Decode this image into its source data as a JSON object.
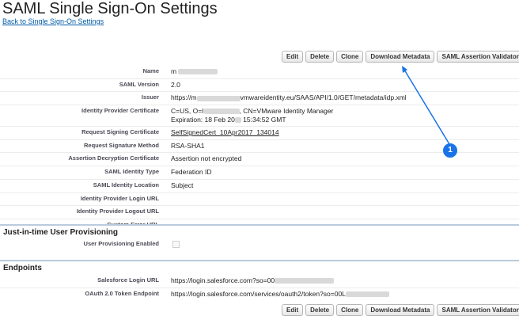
{
  "page": {
    "title": "SAML Single Sign-On Settings",
    "back_link": "Back to Single Sign-On Settings"
  },
  "buttons": {
    "edit": "Edit",
    "delete": "Delete",
    "clone": "Clone",
    "download_metadata": "Download Metadata",
    "saml_assertion_validator": "SAML Assertion Validator"
  },
  "details": {
    "name": {
      "label": "Name",
      "value": "m"
    },
    "saml_version": {
      "label": "SAML Version",
      "value": "2.0"
    },
    "issuer": {
      "label": "Issuer",
      "value_prefix": "https://m",
      "value_suffix": "vmwareidentity.eu/SAAS/API/1.0/GET/metadata/idp.xml"
    },
    "idp_certificate": {
      "label": "Identity Provider Certificate",
      "line1_prefix": "C=US, O=I",
      "line1_suffix": ", CN=VMware Identity Manager",
      "line2_prefix": "Expiration: 18 Feb 20",
      "line2_suffix": " 15:34:52 GMT"
    },
    "request_signing_certificate": {
      "label": "Request Signing Certificate",
      "value": "SelfSignedCert_10Apr2017_134014"
    },
    "request_signature_method": {
      "label": "Request Signature Method",
      "value": "RSA-SHA1"
    },
    "assertion_decryption_certificate": {
      "label": "Assertion Decryption Certificate",
      "value": "Assertion not encrypted"
    },
    "saml_identity_type": {
      "label": "SAML Identity Type",
      "value": "Federation ID"
    },
    "saml_identity_location": {
      "label": "SAML Identity Location",
      "value": "Subject"
    },
    "idp_login_url": {
      "label": "Identity Provider Login URL",
      "value": ""
    },
    "idp_logout_url": {
      "label": "Identity Provider Logout URL",
      "value": ""
    },
    "custom_error_url": {
      "label": "Custom Error URL",
      "value": ""
    }
  },
  "jit": {
    "heading": "Just-in-time User Provisioning",
    "user_provisioning_label": "User Provisioning Enabled"
  },
  "endpoints": {
    "heading": "Endpoints",
    "salesforce_login": {
      "label": "Salesforce Login URL",
      "value": "https://login.salesforce.com?so=00"
    },
    "oauth_token": {
      "label": "OAuth 2.0 Token Endpoint",
      "value": "https://login.salesforce.com/services/oauth2/token?so=00L"
    }
  },
  "callout": {
    "number": "1"
  },
  "colors": {
    "link": "#015ba7",
    "callout": "#1a73e8",
    "section_border": "#b9cbdc"
  }
}
